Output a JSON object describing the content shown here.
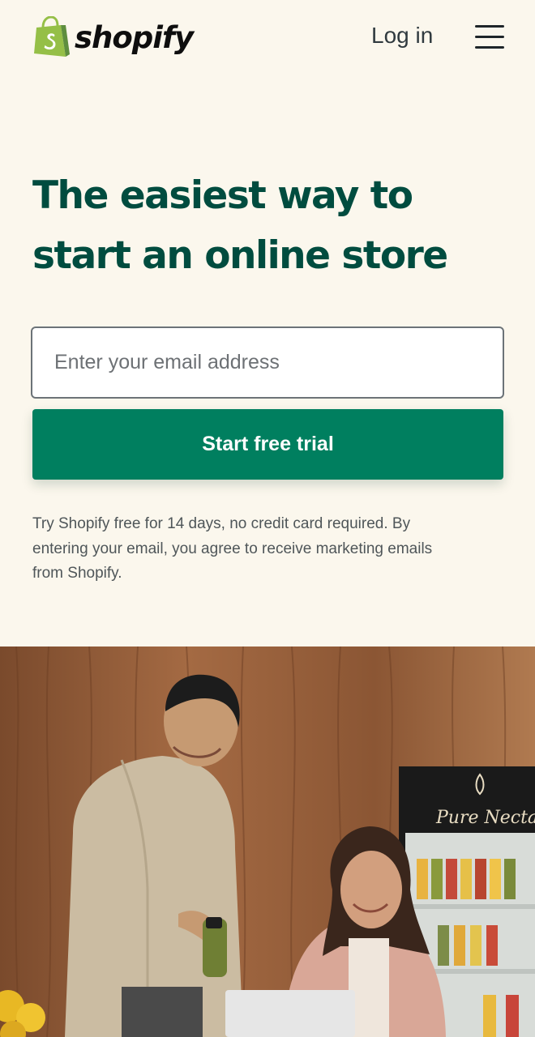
{
  "header": {
    "logo_text": "shopify",
    "login_label": "Log in",
    "menu_icon": "hamburger-menu-icon"
  },
  "hero": {
    "headline": "The easiest way to start an online store",
    "email_placeholder": "Enter your email address",
    "email_value": "",
    "cta_label": "Start free trial",
    "disclaimer": "Try Shopify free for 14 days, no credit card required. By entering your email, you agree to receive marketing emails from Shopify."
  },
  "photo": {
    "fridge_brand": "Pure Nectar"
  },
  "colors": {
    "background": "#fbf7ed",
    "headline": "#004c3f",
    "cta": "#007f5f",
    "logo_green": "#95bf47"
  }
}
